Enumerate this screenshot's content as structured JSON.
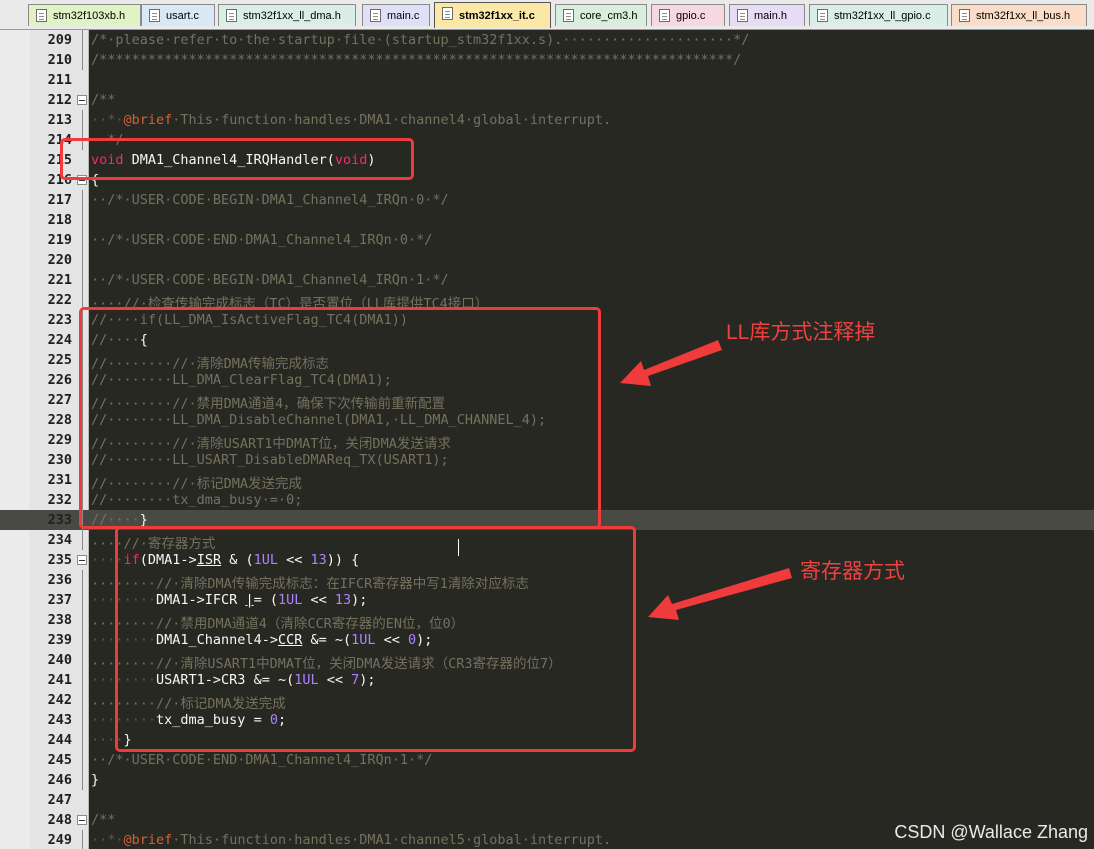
{
  "tabs": [
    {
      "label": "stm32f103xb.h",
      "color": "#dff3c4",
      "active": false
    },
    {
      "label": "usart.c",
      "color": "#d7e8f7",
      "active": false
    },
    {
      "label": "stm32f1xx_ll_dma.h",
      "color": "#d8eee7",
      "active": false
    },
    {
      "label": "main.c",
      "color": "#dfe0f7",
      "active": false
    },
    {
      "label": "stm32f1xx_it.c",
      "color": "#fbe7a6",
      "active": true
    },
    {
      "label": "core_cm3.h",
      "color": "#d9eedd",
      "active": false
    },
    {
      "label": "gpio.c",
      "color": "#f7d7e2",
      "active": false
    },
    {
      "label": "main.h",
      "color": "#e7dbf5",
      "active": false
    },
    {
      "label": "stm32f1xx_ll_gpio.c",
      "color": "#d8eee7",
      "active": false
    },
    {
      "label": "stm32f1xx_ll_bus.h",
      "color": "#fbdcc6",
      "active": false
    }
  ],
  "editor": {
    "current_line": 233,
    "lines": [
      {
        "n": "209",
        "fold": "line",
        "tokens": [
          {
            "t": "/*·please·refer·to·the·startup·file·(startup_stm32f1xx.s).·····················*/",
            "c": "cm"
          }
        ]
      },
      {
        "n": "210",
        "fold": "line",
        "tokens": [
          {
            "t": "/******************************************************************************/",
            "c": "cm"
          }
        ]
      },
      {
        "n": "211",
        "fold": "",
        "tokens": []
      },
      {
        "n": "212",
        "fold": "box",
        "tokens": [
          {
            "t": "/**",
            "c": "cm"
          }
        ]
      },
      {
        "n": "213",
        "fold": "line",
        "tokens": [
          {
            "t": "··*·",
            "c": "ws"
          },
          {
            "t": "@brief",
            "c": "tag"
          },
          {
            "t": "·This·function·handles·DMA1·channel4·global·interrupt.",
            "c": "cm"
          }
        ]
      },
      {
        "n": "214",
        "fold": "line",
        "tokens": [
          {
            "t": "··*/",
            "c": "cm"
          }
        ]
      },
      {
        "n": "215",
        "fold": "",
        "tokens": [
          {
            "t": "void",
            "c": "kw"
          },
          {
            "t": " DMA1_Channel4_IRQHandler(",
            "c": "fn"
          },
          {
            "t": "void",
            "c": "kw"
          },
          {
            "t": ")",
            "c": "fn"
          }
        ]
      },
      {
        "n": "216",
        "fold": "box",
        "tokens": [
          {
            "t": "{",
            "c": "fn"
          }
        ]
      },
      {
        "n": "217",
        "fold": "line",
        "tokens": [
          {
            "t": "··/*·USER·CODE·BEGIN·DMA1_Channel4_IRQn·0·*/",
            "c": "cm"
          }
        ]
      },
      {
        "n": "218",
        "fold": "line",
        "tokens": []
      },
      {
        "n": "219",
        "fold": "line",
        "tokens": [
          {
            "t": "··/*·USER·CODE·END·DMA1_Channel4_IRQn·0·*/",
            "c": "cm"
          }
        ]
      },
      {
        "n": "220",
        "fold": "line",
        "tokens": []
      },
      {
        "n": "221",
        "fold": "line",
        "tokens": [
          {
            "t": "··/*·USER·CODE·BEGIN·DMA1_Channel4_IRQn·1·*/",
            "c": "cm"
          }
        ]
      },
      {
        "n": "222",
        "fold": "line",
        "tokens": [
          {
            "t": "····//·检查传输完成标志（TC）是否置位（LL库提供TC4接口）",
            "c": "cm"
          }
        ]
      },
      {
        "n": "223",
        "fold": "line",
        "tokens": [
          {
            "t": "//····if(LL_DMA_IsActiveFlag_TC4(DMA1))",
            "c": "cm"
          }
        ]
      },
      {
        "n": "224",
        "fold": "line",
        "tokens": [
          {
            "t": "//····",
            "c": "cm"
          },
          {
            "t": "{",
            "c": "fn"
          }
        ]
      },
      {
        "n": "225",
        "fold": "line",
        "tokens": [
          {
            "t": "//········//·清除DMA传输完成标志",
            "c": "cm"
          }
        ]
      },
      {
        "n": "226",
        "fold": "line",
        "tokens": [
          {
            "t": "//········LL_DMA_ClearFlag_TC4(DMA1);",
            "c": "cm"
          }
        ]
      },
      {
        "n": "227",
        "fold": "line",
        "tokens": [
          {
            "t": "//········//·禁用DMA通道4，确保下次传输前重新配置",
            "c": "cm"
          }
        ]
      },
      {
        "n": "228",
        "fold": "line",
        "tokens": [
          {
            "t": "//········LL_DMA_DisableChannel(DMA1,·LL_DMA_CHANNEL_4);",
            "c": "cm"
          }
        ]
      },
      {
        "n": "229",
        "fold": "line",
        "tokens": [
          {
            "t": "//········//·清除USART1中DMAT位，关闭DMA发送请求",
            "c": "cm"
          }
        ]
      },
      {
        "n": "230",
        "fold": "line",
        "tokens": [
          {
            "t": "//········LL_USART_DisableDMAReq_TX(USART1);",
            "c": "cm"
          }
        ]
      },
      {
        "n": "231",
        "fold": "line",
        "tokens": [
          {
            "t": "//········//·标记DMA发送完成",
            "c": "cm"
          }
        ]
      },
      {
        "n": "232",
        "fold": "line",
        "tokens": [
          {
            "t": "//········tx_dma_busy·=·0;",
            "c": "cm"
          }
        ]
      },
      {
        "n": "233",
        "fold": "line",
        "tokens": [
          {
            "t": "//····",
            "c": "cm"
          },
          {
            "t": "}",
            "c": "fn"
          }
        ]
      },
      {
        "n": "234",
        "fold": "line",
        "tokens": [
          {
            "t": "····//·寄存器方式",
            "c": "cm"
          }
        ]
      },
      {
        "n": "235",
        "fold": "box",
        "tokens": [
          {
            "t": "····",
            "c": "ws"
          },
          {
            "t": "if",
            "c": "kw"
          },
          {
            "t": "(DMA1->",
            "c": "fn"
          },
          {
            "t": "ISR",
            "c": "fn",
            "u": true
          },
          {
            "t": " & (",
            "c": "fn"
          },
          {
            "t": "1UL",
            "c": "num"
          },
          {
            "t": " << ",
            "c": "fn"
          },
          {
            "t": "13",
            "c": "num"
          },
          {
            "t": ")) {",
            "c": "fn"
          }
        ]
      },
      {
        "n": "236",
        "fold": "line",
        "tokens": [
          {
            "t": "········//·清除DMA传输完成标志：在IFCR寄存器中写1清除对应标志",
            "c": "cm"
          }
        ]
      },
      {
        "n": "237",
        "fold": "line",
        "tokens": [
          {
            "t": "········",
            "c": "ws"
          },
          {
            "t": "DMA1->IFCR ",
            "c": "fn"
          },
          {
            "t": "|",
            "c": "fn",
            "u": true
          },
          {
            "t": "= (",
            "c": "fn"
          },
          {
            "t": "1UL",
            "c": "num"
          },
          {
            "t": " << ",
            "c": "fn"
          },
          {
            "t": "13",
            "c": "num"
          },
          {
            "t": ");",
            "c": "fn"
          }
        ]
      },
      {
        "n": "238",
        "fold": "line",
        "tokens": [
          {
            "t": "········//·禁用DMA通道4（清除CCR寄存器的EN位，位0）",
            "c": "cm"
          }
        ]
      },
      {
        "n": "239",
        "fold": "line",
        "tokens": [
          {
            "t": "········",
            "c": "ws"
          },
          {
            "t": "DMA1_Channel4->",
            "c": "fn"
          },
          {
            "t": "CCR",
            "c": "fn",
            "u": true
          },
          {
            "t": " &= ~(",
            "c": "fn"
          },
          {
            "t": "1UL",
            "c": "num"
          },
          {
            "t": " << ",
            "c": "fn"
          },
          {
            "t": "0",
            "c": "num"
          },
          {
            "t": ");",
            "c": "fn"
          }
        ]
      },
      {
        "n": "240",
        "fold": "line",
        "tokens": [
          {
            "t": "········//·清除USART1中DMAT位，关闭DMA发送请求（CR3寄存器的位7）",
            "c": "cm"
          }
        ]
      },
      {
        "n": "241",
        "fold": "line",
        "tokens": [
          {
            "t": "········",
            "c": "ws"
          },
          {
            "t": "USART1->CR3 &= ~(",
            "c": "fn"
          },
          {
            "t": "1UL",
            "c": "num"
          },
          {
            "t": " << ",
            "c": "fn"
          },
          {
            "t": "7",
            "c": "num"
          },
          {
            "t": ");",
            "c": "fn"
          }
        ]
      },
      {
        "n": "242",
        "fold": "line",
        "tokens": [
          {
            "t": "········//·标记DMA发送完成",
            "c": "cm"
          }
        ]
      },
      {
        "n": "243",
        "fold": "line",
        "tokens": [
          {
            "t": "········",
            "c": "ws"
          },
          {
            "t": "tx_dma_busy = ",
            "c": "fn"
          },
          {
            "t": "0",
            "c": "num"
          },
          {
            "t": ";",
            "c": "fn"
          }
        ]
      },
      {
        "n": "244",
        "fold": "line",
        "tokens": [
          {
            "t": "····",
            "c": "ws"
          },
          {
            "t": "}",
            "c": "fn"
          }
        ]
      },
      {
        "n": "245",
        "fold": "line",
        "tokens": [
          {
            "t": "··/*·USER·CODE·END·DMA1_Channel4_IRQn·1·*/",
            "c": "cm"
          }
        ]
      },
      {
        "n": "246",
        "fold": "line",
        "tokens": [
          {
            "t": "}",
            "c": "fn"
          }
        ]
      },
      {
        "n": "247",
        "fold": "",
        "tokens": []
      },
      {
        "n": "248",
        "fold": "box",
        "tokens": [
          {
            "t": "/**",
            "c": "cm"
          }
        ]
      },
      {
        "n": "249",
        "fold": "line",
        "tokens": [
          {
            "t": "··*·",
            "c": "ws"
          },
          {
            "t": "@brief",
            "c": "tag"
          },
          {
            "t": "·This·function·handles·DMA1·channel5·global·interrupt.",
            "c": "cm"
          }
        ]
      }
    ]
  },
  "annotations": {
    "ll_label": "LL库方式注释掉",
    "reg_label": "寄存器方式",
    "color": "#ef3b3b"
  },
  "watermark": "CSDN @Wallace Zhang"
}
